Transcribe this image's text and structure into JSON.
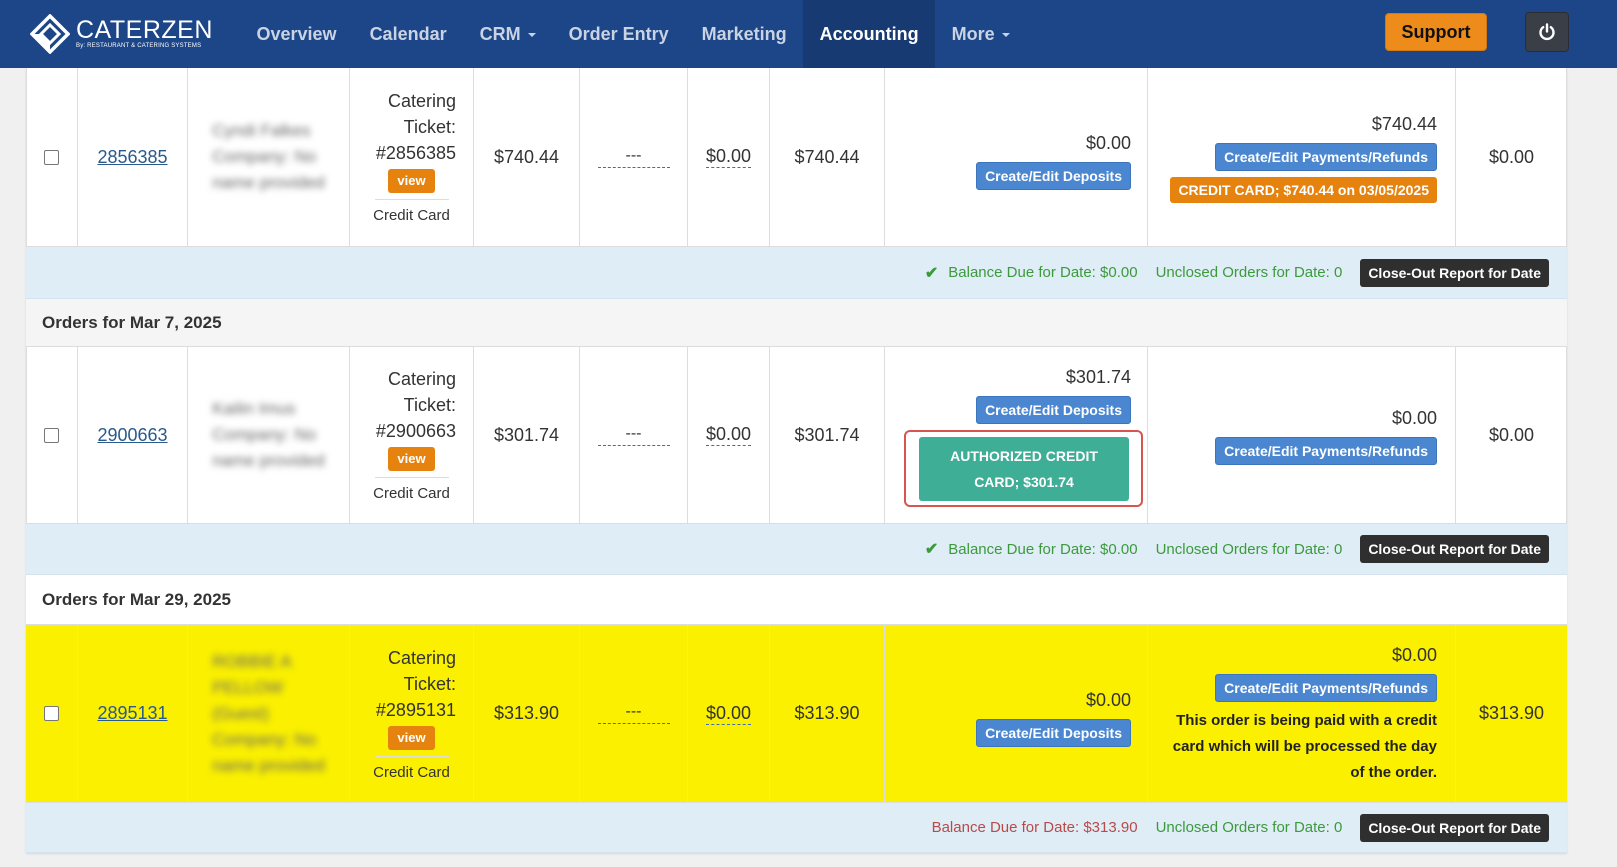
{
  "brand": {
    "name": "CATERZEN",
    "sub": "By: RESTAURANT & CATERING SYSTEMS"
  },
  "nav": {
    "items": [
      {
        "label": "Overview"
      },
      {
        "label": "Calendar"
      },
      {
        "label": "CRM"
      },
      {
        "label": "Order Entry"
      },
      {
        "label": "Marketing"
      },
      {
        "label": "Accounting"
      },
      {
        "label": "More"
      }
    ],
    "active": "Accounting",
    "support_label": "Support",
    "power_icon": "power-icon"
  },
  "colors": {
    "navbar": "#1d4688",
    "support": "#ee8c1b",
    "blue_button": "#4a87d0",
    "orange": "#e6830f",
    "authorized": "#3fae97",
    "highlight_row": "#faf000",
    "summary_bg": "#dfedf7"
  },
  "orders": [
    {
      "id": "2856385",
      "customer_lines": [
        "Cyndi Falkes",
        "Company: No",
        "name provided"
      ],
      "ticket_lines": [
        "Catering",
        "Ticket:",
        "#2856385"
      ],
      "view_label": "view",
      "payment_method": "Credit Card",
      "total": "$740.44",
      "dash": "---",
      "tip": "$0.00",
      "grand_total": "$740.44",
      "deposit_amount": "$0.00",
      "deposit_button": "Create/Edit Deposits",
      "payments_amount": "$740.44",
      "payments_button": "Create/Edit Payments/Refunds",
      "payment_badge": "CREDIT CARD; $740.44 on 03/05/2025",
      "balance": "$0.00"
    },
    {
      "id": "2900663",
      "customer_lines": [
        "Kailin Imus",
        "Company: No",
        "name provided"
      ],
      "ticket_lines": [
        "Catering",
        "Ticket:",
        "#2900663"
      ],
      "view_label": "view",
      "payment_method": "Credit Card",
      "total": "$301.74",
      "dash": "---",
      "tip": "$0.00",
      "grand_total": "$301.74",
      "deposit_amount": "$301.74",
      "deposit_button": "Create/Edit Deposits",
      "authorized_badge": "AUTHORIZED CREDIT CARD; $301.74",
      "payments_amount": "$0.00",
      "payments_button": "Create/Edit Payments/Refunds",
      "balance": "$0.00"
    },
    {
      "id": "2895131",
      "customer_lines": [
        "ROBBIE A",
        "PELLOW",
        "(Guest)",
        "Company: No",
        "name provided"
      ],
      "ticket_lines": [
        "Catering",
        "Ticket:",
        "#2895131"
      ],
      "view_label": "view",
      "payment_method": "Credit Card",
      "total": "$313.90",
      "dash": "---",
      "tip": "$0.00",
      "grand_total": "$313.90",
      "deposit_amount": "$0.00",
      "deposit_button": "Create/Edit Deposits",
      "payments_amount": "$0.00",
      "payments_button": "Create/Edit Payments/Refunds",
      "payment_note": "This order is being paid with a credit card which will be processed the day of the order.",
      "balance": "$313.90"
    }
  ],
  "summaries": [
    {
      "balance_text": "Balance Due for Date: $0.00",
      "unclosed_text": "Unclosed Orders for Date: 0",
      "button": "Close-Out Report for Date"
    },
    {
      "balance_text": "Balance Due for Date: $0.00",
      "unclosed_text": "Unclosed Orders for Date: 0",
      "button": "Close-Out Report for Date"
    },
    {
      "balance_text": "Balance Due for Date: $313.90",
      "unclosed_text": "Unclosed Orders for Date: 0",
      "button": "Close-Out Report for Date"
    }
  ],
  "date_headers": [
    {
      "label": "Orders for Mar 7, 2025"
    },
    {
      "label": "Orders for Mar 29, 2025"
    }
  ]
}
